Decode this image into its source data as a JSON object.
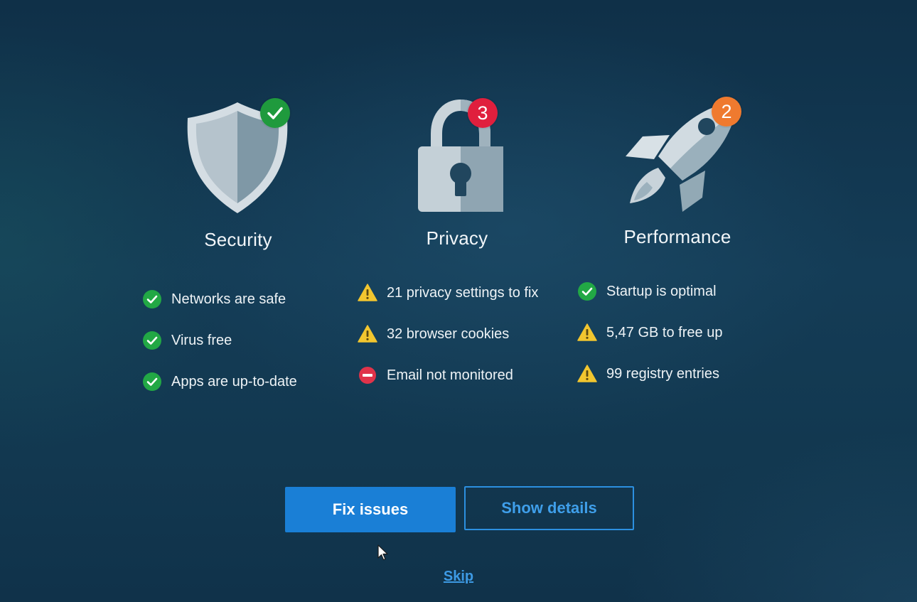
{
  "security": {
    "title": "Security",
    "icon": "shield-icon",
    "badge_icon": "check-badge-icon",
    "items": [
      {
        "icon": "check-circle-icon",
        "label": "Networks are safe"
      },
      {
        "icon": "check-circle-icon",
        "label": "Virus free"
      },
      {
        "icon": "check-circle-icon",
        "label": "Apps are up-to-date"
      }
    ]
  },
  "privacy": {
    "title": "Privacy",
    "icon": "padlock-icon",
    "badge": "3",
    "items": [
      {
        "icon": "warning-triangle-icon",
        "label": "21 privacy settings to fix"
      },
      {
        "icon": "warning-triangle-icon",
        "label": "32 browser cookies"
      },
      {
        "icon": "minus-circle-icon",
        "label": "Email not monitored"
      }
    ]
  },
  "performance": {
    "title": "Performance",
    "icon": "rocket-icon",
    "badge": "2",
    "items": [
      {
        "icon": "check-circle-icon",
        "label": "Startup is optimal"
      },
      {
        "icon": "warning-triangle-icon",
        "label": "5,47 GB to free up"
      },
      {
        "icon": "warning-triangle-icon",
        "label": "99 registry entries"
      }
    ]
  },
  "actions": {
    "fix_label": "Fix issues",
    "details_label": "Show details",
    "skip_label": "Skip"
  },
  "colors": {
    "ok": "#22a845",
    "warning": "#f2c62f",
    "error": "#e0334a",
    "badge_privacy": "#e01f3d",
    "badge_performance": "#ef7a2f",
    "accent": "#1a7fd6"
  }
}
